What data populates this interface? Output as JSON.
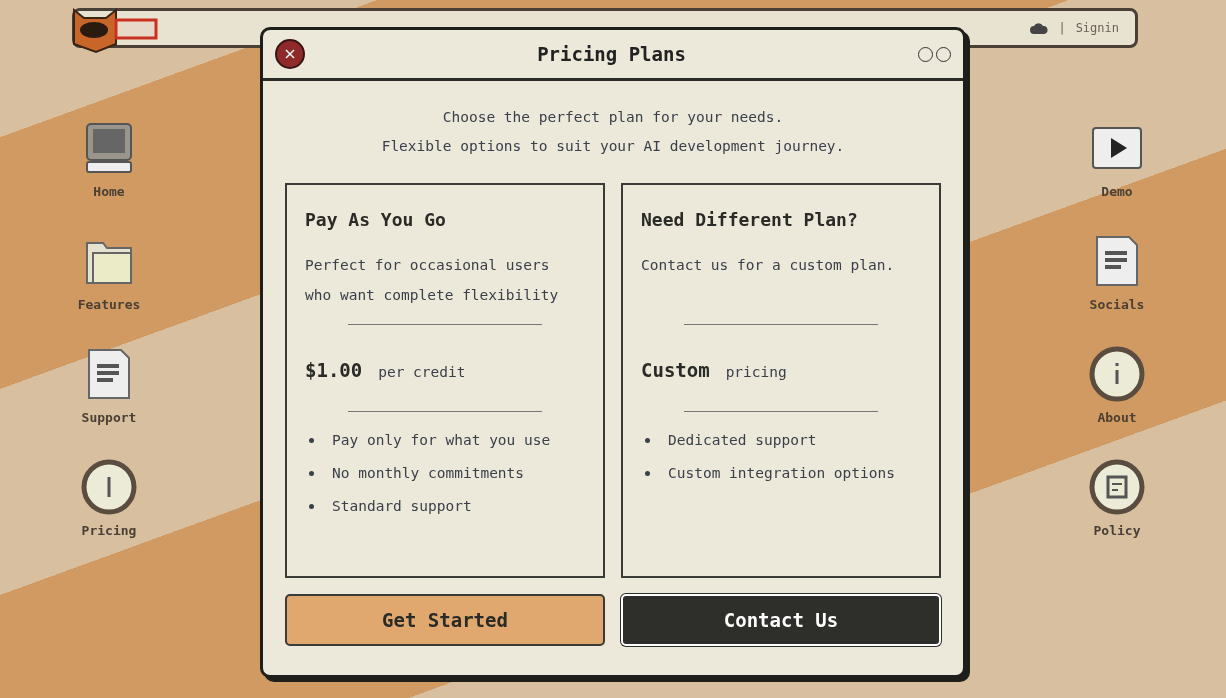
{
  "topbar": {
    "separator": "|",
    "signin": "Signin"
  },
  "desktop_left": [
    {
      "label": "Home",
      "kind": "computer"
    },
    {
      "label": "Features",
      "kind": "folder"
    },
    {
      "label": "Support",
      "kind": "document"
    },
    {
      "label": "Pricing",
      "kind": "coin"
    }
  ],
  "desktop_right": [
    {
      "label": "Demo",
      "kind": "play"
    },
    {
      "label": "Socials",
      "kind": "document"
    },
    {
      "label": "About",
      "kind": "info"
    },
    {
      "label": "Policy",
      "kind": "policy"
    }
  ],
  "window": {
    "title": "Pricing Plans",
    "intro": [
      "Choose the perfect plan for your needs.",
      "Flexible options to suit your AI development journey."
    ]
  },
  "plans": [
    {
      "name": "Pay As You Go",
      "description": "Perfect for occasional users who want complete flexibility",
      "price": "$1.00",
      "unit": "per credit",
      "features": [
        "Pay only for what you use",
        "No monthly commitments",
        "Standard support"
      ],
      "button": "Get Started",
      "kind": "primary"
    },
    {
      "name": "Need Different Plan?",
      "description": "Contact us for a custom plan.",
      "price": "Custom",
      "unit": "pricing",
      "features": [
        "Dedicated support",
        "Custom integration options"
      ],
      "button": "Contact Us",
      "kind": "dark"
    }
  ]
}
